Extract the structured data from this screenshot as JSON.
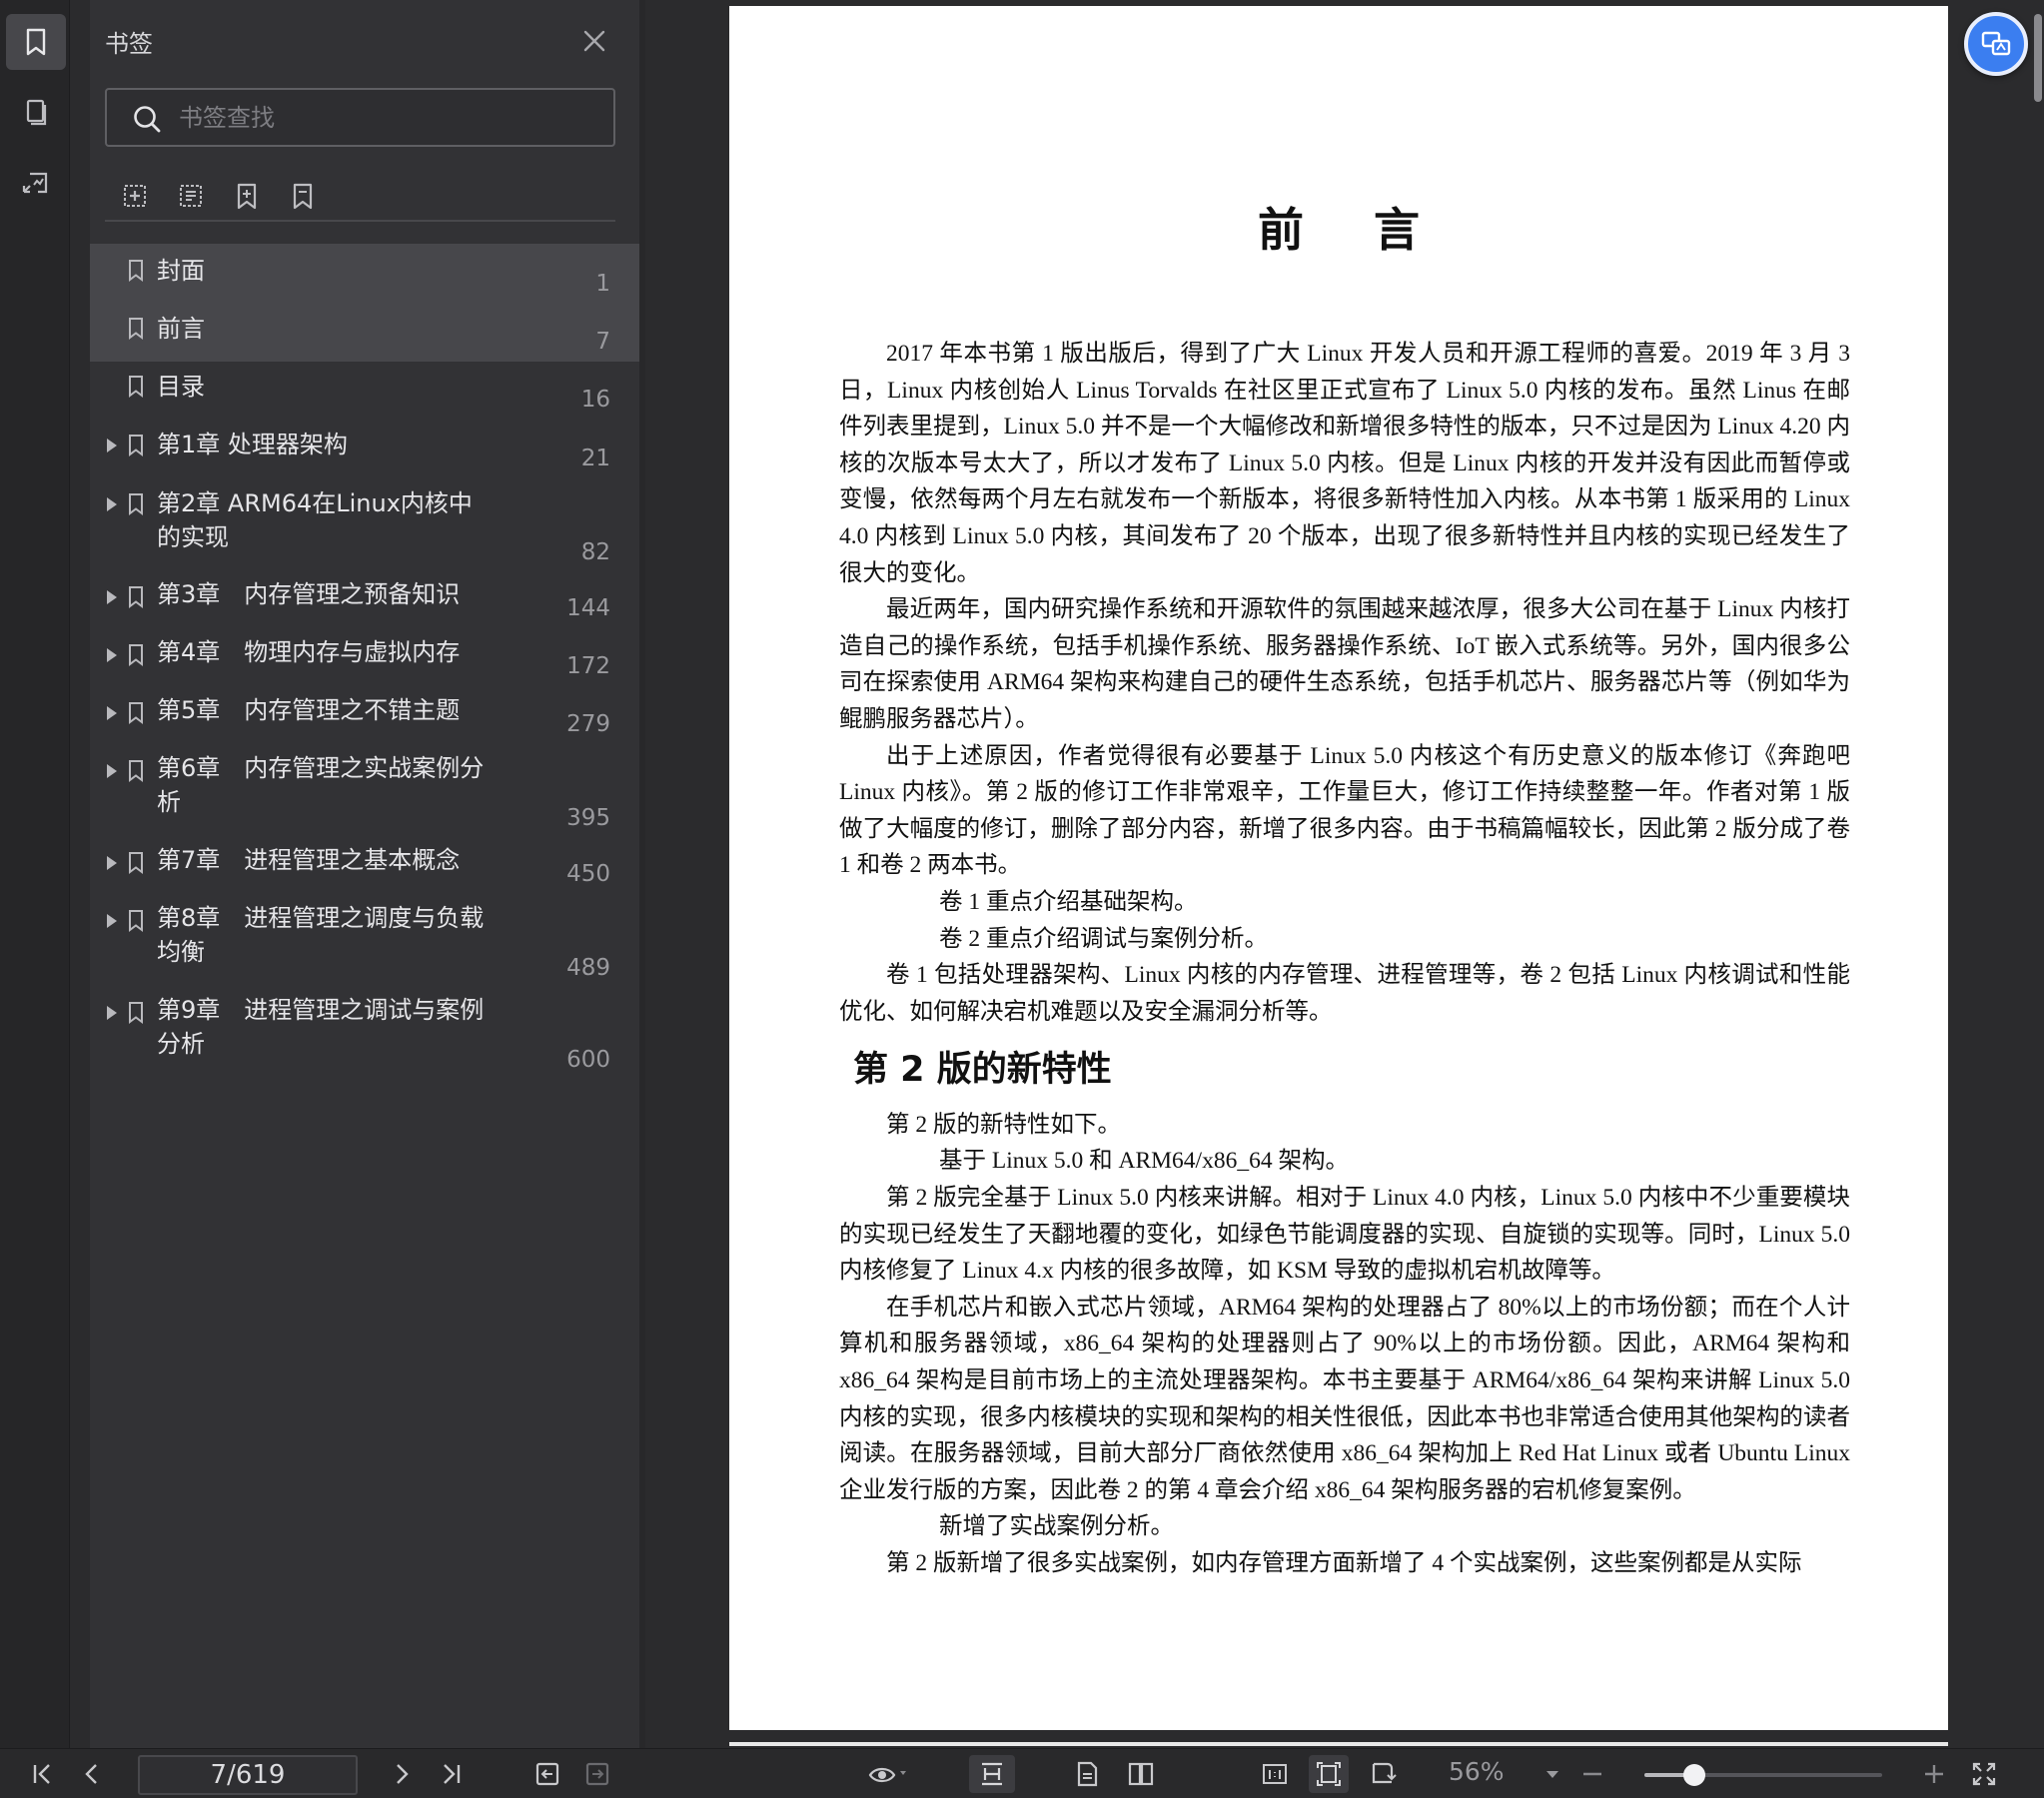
{
  "bookmark_panel": {
    "title": "书签",
    "search_placeholder": "书签查找",
    "items": [
      {
        "label": "封面",
        "page": "1",
        "expandable": false
      },
      {
        "label": "前言",
        "page": "7",
        "expandable": false
      },
      {
        "label": "目录",
        "page": "16",
        "expandable": false
      },
      {
        "label": "第1章 处理器架构",
        "page": "21",
        "expandable": true
      },
      {
        "label": "第2章 ARM64在Linux内核中\n的实现",
        "page": "82",
        "expandable": true
      },
      {
        "label": "第3章　内存管理之预备知识",
        "page": "144",
        "expandable": true
      },
      {
        "label": "第4章　物理内存与虚拟内存",
        "page": "172",
        "expandable": true
      },
      {
        "label": "第5章　内存管理之不错主题",
        "page": "279",
        "expandable": true
      },
      {
        "label": "第6章　内存管理之实战案例分\n析",
        "page": "395",
        "expandable": true
      },
      {
        "label": "第7章　进程管理之基本概念",
        "page": "450",
        "expandable": true
      },
      {
        "label": "第8章　进程管理之调度与负载\n均衡",
        "page": "489",
        "expandable": true
      },
      {
        "label": "第9章　进程管理之调试与案例\n分析",
        "page": "600",
        "expandable": true
      }
    ]
  },
  "document": {
    "title": "前言",
    "paragraphs": [
      {
        "type": "p",
        "text": "2017 年本书第 1 版出版后，得到了广大 Linux 开发人员和开源工程师的喜爱。2019 年 3 月 3 日，Linux 内核创始人 Linus Torvalds 在社区里正式宣布了 Linux 5.0 内核的发布。虽然 Linus 在邮件列表里提到，Linux 5.0 并不是一个大幅修改和新增很多特性的版本，只不过是因为 Linux 4.20 内核的次版本号太大了，所以才发布了 Linux 5.0 内核。但是 Linux 内核的开发并没有因此而暂停或变慢，依然每两个月左右就发布一个新版本，将很多新特性加入内核。从本书第 1 版采用的 Linux 4.0 内核到 Linux 5.0 内核，其间发布了 20 个版本，出现了很多新特性并且内核的实现已经发生了很大的变化。"
      },
      {
        "type": "p",
        "text": "最近两年，国内研究操作系统和开源软件的氛围越来越浓厚，很多大公司在基于 Linux 内核打造自己的操作系统，包括手机操作系统、服务器操作系统、IoT 嵌入式系统等。另外，国内很多公司在探索使用 ARM64 架构来构建自己的硬件生态系统，包括手机芯片、服务器芯片等（例如华为鲲鹏服务器芯片）。"
      },
      {
        "type": "p",
        "text": "出于上述原因，作者觉得很有必要基于 Linux 5.0 内核这个有历史意义的版本修订《奔跑吧 Linux 内核》。第 2 版的修订工作非常艰辛，工作量巨大，修订工作持续整整一年。作者对第 1 版做了大幅度的修订，删除了部分内容，新增了很多内容。由于书稿篇幅较长，因此第 2 版分成了卷 1 和卷 2 两本书。"
      },
      {
        "type": "bullet",
        "text": "卷 1 重点介绍基础架构。"
      },
      {
        "type": "bullet",
        "text": "卷 2 重点介绍调试与案例分析。"
      },
      {
        "type": "p",
        "text": "卷 1 包括处理器架构、Linux 内核的内存管理、进程管理等，卷 2 包括 Linux 内核调试和性能优化、如何解决宕机难题以及安全漏洞分析等。"
      },
      {
        "type": "h2",
        "text": "第 2 版的新特性"
      },
      {
        "type": "p",
        "text": "第 2 版的新特性如下。"
      },
      {
        "type": "bullet",
        "text": "基于 Linux 5.0 和 ARM64/x86_64 架构。"
      },
      {
        "type": "p",
        "text": "第 2 版完全基于 Linux 5.0 内核来讲解。相对于 Linux 4.0 内核，Linux 5.0 内核中不少重要模块的实现已经发生了天翻地覆的变化，如绿色节能调度器的实现、自旋锁的实现等。同时，Linux 5.0 内核修复了 Linux 4.x 内核的很多故障，如 KSM 导致的虚拟机宕机故障等。"
      },
      {
        "type": "p",
        "text": "在手机芯片和嵌入式芯片领域，ARM64 架构的处理器占了 80%以上的市场份额；而在个人计算机和服务器领域，x86_64 架构的处理器则占了 90%以上的市场份额。因此，ARM64 架构和 x86_64 架构是目前市场上的主流处理器架构。本书主要基于 ARM64/x86_64 架构来讲解 Linux 5.0 内核的实现，很多内核模块的实现和架构的相关性很低，因此本书也非常适合使用其他架构的读者阅读。在服务器领域，目前大部分厂商依然使用 x86_64 架构加上 Red Hat Linux 或者 Ubuntu Linux 企业发行版的方案，因此卷 2 的第 4 章会介绍 x86_64 架构服务器的宕机修复案例。"
      },
      {
        "type": "bullet",
        "text": "新增了实战案例分析。"
      },
      {
        "type": "p",
        "text": "第 2 版新增了很多实战案例，如内存管理方面新增了 4 个实战案例，这些案例都是从实际"
      }
    ]
  },
  "statusbar": {
    "page_indicator": "7/619",
    "zoom_label": "56%",
    "zoom_fraction": 0.21
  },
  "colors": {
    "accent": "#3b7ef0",
    "panel_bg": "#323235",
    "selected_row": "#47474b"
  }
}
